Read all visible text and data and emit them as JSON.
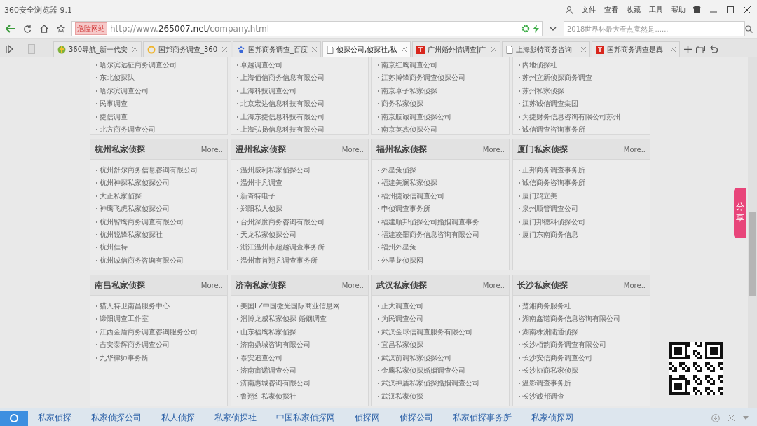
{
  "window": {
    "title": "360安全浏览器 9.1",
    "menu": [
      "文件",
      "查看",
      "收藏",
      "工具",
      "帮助"
    ]
  },
  "address_bar": {
    "badge": "危险网站",
    "url": "http://www.**265007.net**/company.html",
    "search_placeholder": "2018世界杯最大看点竟然是......"
  },
  "tabs": [
    {
      "label": "360导航_新一代安",
      "kind": "globe",
      "selected": false
    },
    {
      "label": "国邦商务调查_360",
      "kind": "ring",
      "selected": false
    },
    {
      "label": "国邦商务调查_百度",
      "kind": "paw",
      "selected": false
    },
    {
      "label": "侦探公司,侦探社,私",
      "kind": "page",
      "selected": true
    },
    {
      "label": "广州婚外情调查|广",
      "kind": "mark",
      "selected": false
    },
    {
      "label": "上海影特商务咨询",
      "kind": "page",
      "selected": false
    },
    {
      "label": "国邦商务调查是真",
      "kind": "mark",
      "selected": false
    }
  ],
  "top_lists": [
    [
      "哈尔滨远征商务调查公司",
      "东北侦探队",
      "哈尔滨调查公司",
      "民事调查",
      "捷信调查",
      "北方商务调查公司"
    ],
    [
      "卓越调查公司",
      "上海佰信商务信息有限公司",
      "上海科技调查公司",
      "北京宏达信息科技有限公司",
      "上海东捷信息科技有限公司",
      "上海弘扬信息科技有限公司"
    ],
    [
      "南京红鹰调查公司",
      "江苏博锋商务调查侦探公司",
      "南京卓子私家侦探",
      "商务私家侦探",
      "南京航诚调查侦探公司",
      "南京英杰侦探公司"
    ],
    [
      "内地侦探社",
      "苏州立新侦探商务调查",
      "苏州私家侦探",
      "江苏诚信调查集团",
      "为捷财务信息咨询有限公司苏州",
      "诚信调查咨询事务所"
    ]
  ],
  "panel_rows": [
    [
      {
        "title": "杭州私家侦探",
        "more": "More..",
        "items": [
          "杭州舒尔商务信息咨询有限公司",
          "杭州神探私家侦探公司",
          "大正私家侦探",
          "神鹰飞虎私家侦探公司",
          "杭州智鹰商务调查有限公司",
          "杭州锐锋私家侦探社",
          "杭州佳特",
          "杭州诚信商务咨询有限公司"
        ]
      },
      {
        "title": "温州私家侦探",
        "more": "More..",
        "items": [
          "温州威利私家侦探公司",
          "温州非凡调查",
          "新奇特电子",
          "郑阳私人侦探",
          "台州深度商务咨询有限公司",
          "天龙私家侦探公司",
          "浙江温州市超越调查事务所",
          "温州市首翔凡调查事务所"
        ]
      },
      {
        "title": "福州私家侦探",
        "more": "More..",
        "items": [
          "外星兔侦探",
          "福建美澜私家侦探",
          "福州捷诚信调查公司",
          "申侦调查事务所",
          "福建顺邦侦探公司婚姻调查事务",
          "福建凌墨商务信息咨询有限公司",
          "福州外星兔",
          "外星龙侦探网"
        ]
      },
      {
        "title": "厦门私家侦探",
        "more": "More..",
        "items": [
          "正邦商务调查事务所",
          "诚信商务咨询事务所",
          "厦门鸡立美",
          "泉州顺管调查公司",
          "厦门邦德科侦探公司",
          "厦门东南商务信息"
        ]
      }
    ],
    [
      {
        "title": "南昌私家侦探",
        "more": "More..",
        "items": [
          "猎人特卫南昌服务中心",
          "谛阳调查工作室",
          "江西金盾商务调查咨询服务公司",
          "吉安泰辉商务调查公司",
          "九华律师事务所"
        ]
      },
      {
        "title": "济南私家侦探",
        "more": "More..",
        "items": [
          "美国LZ中国微光国际商业信息网",
          "淄博龙威私家侦探 婚姻调查",
          "山东福鹰私家侦探",
          "济南鼎城咨询有限公司",
          "泰安追查公司",
          "济南宙诺调查公司",
          "济南惠城咨询有限公司",
          "鲁翔红私家侦探社"
        ]
      },
      {
        "title": "武汉私家侦探",
        "more": "More..",
        "items": [
          "正大调查公司",
          "为民调查公司",
          "武汉金球信调查服务有限公司",
          "宜昌私家侦探",
          "武汉前调私家侦探公司",
          "金鹰私家侦探婚姻调查公司",
          "武汉神盾私家侦探婚姻调查公司",
          "武汉私家侦探"
        ]
      },
      {
        "title": "长沙私家侦探",
        "more": "More..",
        "items": [
          "楚湘商务服务社",
          "湖南鑫诺商务信息咨询有限公司",
          "湖南株洲陆通侦探",
          "长沙栢韵商务调查有限公司",
          "长沙安信商务调查公司",
          "长沙协商私家侦探",
          "温影调查事务所",
          "长沙诚邦调查"
        ]
      }
    ]
  ],
  "share_button": "分享",
  "bottom_links": [
    "私家侦探",
    "私家侦探公司",
    "私人侦探",
    "私家侦探社",
    "中国私家侦探网",
    "侦探网",
    "侦探公司",
    "私家侦探事务所",
    "私家侦探网"
  ]
}
